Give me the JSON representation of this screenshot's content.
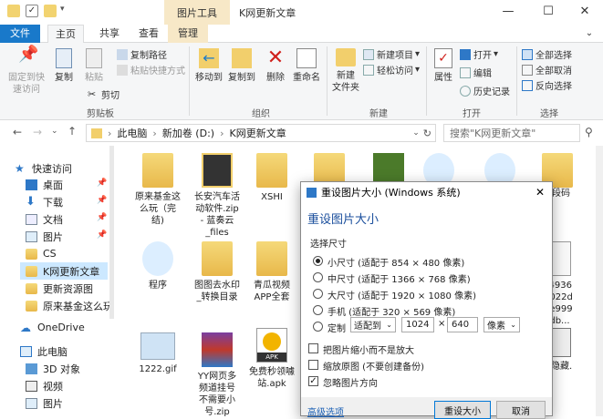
{
  "titlebar": {
    "context_tab": "图片工具",
    "window_title": "K网更新文章",
    "minimize": "—",
    "maximize": "☐",
    "close": "✕"
  },
  "tabs": {
    "file": "文件",
    "home": "主页",
    "share": "共享",
    "view": "查看",
    "manage": "管理"
  },
  "ribbon": {
    "pin": "固定到快\n速访问",
    "copy": "复制",
    "paste": "粘贴",
    "copy_path": "复制路径",
    "paste_shortcut": "粘贴快捷方式",
    "cut": "剪切",
    "clipboard_group": "剪贴板",
    "move_to": "移动到",
    "copy_to": "复制到",
    "delete": "删除",
    "rename": "重命名",
    "organize_group": "组织",
    "new_folder": "新建\n文件夹",
    "new_item": "新建项目",
    "easy_access": "轻松访问",
    "new_group": "新建",
    "properties": "属性",
    "open": "打开",
    "edit": "编辑",
    "history": "历史记录",
    "open_group": "打开",
    "select_all": "全部选择",
    "select_none": "全部取消",
    "invert": "反向选择",
    "select_group": "选择"
  },
  "address": {
    "path": [
      "此电脑",
      "新加卷 (D:)",
      "K网更新文章"
    ],
    "search_placeholder": "搜索\"K网更新文章\""
  },
  "sidebar": {
    "items": [
      {
        "label": "快速访问"
      },
      {
        "label": "桌面"
      },
      {
        "label": "下载"
      },
      {
        "label": "文档"
      },
      {
        "label": "图片"
      },
      {
        "label": "CS"
      },
      {
        "label": "K网更新文章"
      },
      {
        "label": "更新资源图"
      },
      {
        "label": "原来基金这么玩"
      },
      {
        "label": "OneDrive"
      },
      {
        "label": "此电脑"
      },
      {
        "label": "3D 对象"
      },
      {
        "label": "视频"
      },
      {
        "label": "图片"
      }
    ]
  },
  "files": [
    {
      "name": "原来基金这\n么玩（完\n结)"
    },
    {
      "name": "长安汽车活\n动软件.zip\n- 蓝奏云\n_files"
    },
    {
      "name": "XSHI"
    },
    {
      "name": "程序"
    },
    {
      "name": "图图去水印\n_转换目录"
    },
    {
      "name": "青瓜视频\nAPP全套"
    },
    {
      "name": "1222.gif"
    },
    {
      "name": "YY网页多\n频道挂号\n不需要小\n号.zip"
    },
    {
      "name": "免费秒领噱\n站.apk"
    },
    {
      "name": "段码"
    },
    {
      "name": "c4936\n7022d\n0e999\n4db..."
    },
    {
      "name": "隐藏."
    }
  ],
  "apk_label": "APK",
  "dialog": {
    "title": "重设图片大小 (Windows 系统)",
    "heading": "重设图片大小",
    "size_label": "选择尺寸",
    "options": [
      "小尺寸 (适配于 854 × 480 像素)",
      "中尺寸 (适配于 1366 × 768 像素)",
      "大尺寸 (适配于 1920 × 1080 像素)",
      "手机 (适配于 320 × 569 像素)"
    ],
    "custom": "定制",
    "fit": "适配到",
    "width": "1024",
    "times": "×",
    "height": "640",
    "unit": "像素",
    "check_no_enlarge": "把图片缩小而不是放大",
    "check_resize_original": "缩放原图 (不要创建备份)",
    "check_ignore_rotation": "忽略图片方向",
    "advanced": "高级选项",
    "resize_button": "重设大小",
    "cancel_button": "取消"
  },
  "colors": {
    "accent": "#1979ca",
    "context": "#f7e8c7",
    "folder": "#e8b84a"
  }
}
